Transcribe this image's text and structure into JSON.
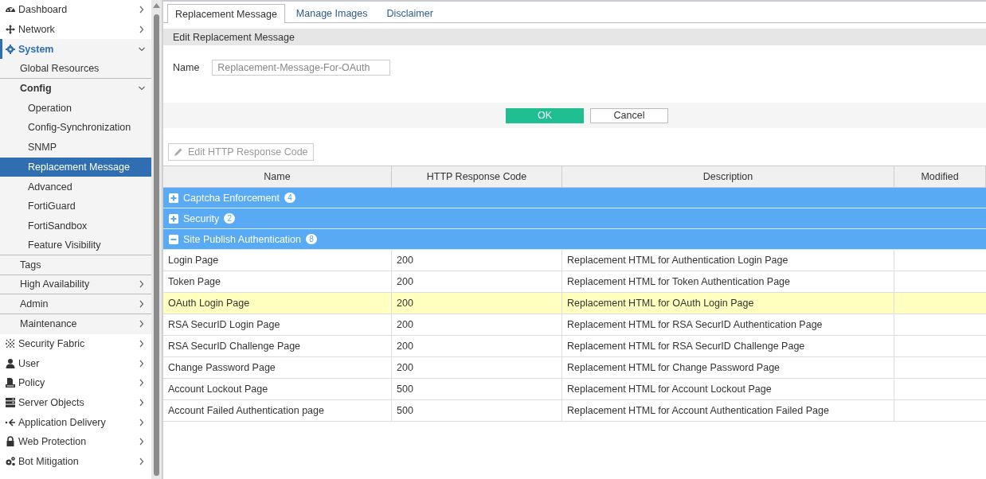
{
  "sidebar": {
    "items": [
      {
        "label": "Dashboard",
        "expanded": false,
        "selected": false
      },
      {
        "label": "Network",
        "expanded": false,
        "selected": false
      },
      {
        "label": "System",
        "expanded": true,
        "selected": false,
        "children": [
          {
            "label": "Global Resources",
            "selected": false
          },
          {
            "label": "Config",
            "expanded": true,
            "selected": false,
            "children": [
              {
                "label": "Operation",
                "selected": false
              },
              {
                "label": "Config-Synchronization",
                "selected": false
              },
              {
                "label": "SNMP",
                "selected": false
              },
              {
                "label": "Replacement Message",
                "selected": true
              },
              {
                "label": "Advanced",
                "selected": false
              },
              {
                "label": "FortiGuard",
                "selected": false
              },
              {
                "label": "FortiSandbox",
                "selected": false
              },
              {
                "label": "Feature Visibility",
                "selected": false
              }
            ]
          },
          {
            "label": "Tags",
            "selected": false
          },
          {
            "label": "High Availability",
            "expanded": false,
            "selected": false
          },
          {
            "label": "Admin",
            "expanded": false,
            "selected": false
          },
          {
            "label": "Maintenance",
            "expanded": false,
            "selected": false
          }
        ]
      },
      {
        "label": "Security Fabric",
        "expanded": false,
        "selected": false
      },
      {
        "label": "User",
        "expanded": false,
        "selected": false
      },
      {
        "label": "Policy",
        "expanded": false,
        "selected": false
      },
      {
        "label": "Server Objects",
        "expanded": false,
        "selected": false
      },
      {
        "label": "Application Delivery",
        "expanded": false,
        "selected": false
      },
      {
        "label": "Web Protection",
        "expanded": false,
        "selected": false
      },
      {
        "label": "Bot Mitigation",
        "expanded": false,
        "selected": false
      }
    ]
  },
  "tabs": [
    {
      "label": "Replacement Message",
      "selected": true
    },
    {
      "label": "Manage Images",
      "selected": false
    },
    {
      "label": "Disclaimer",
      "selected": false
    }
  ],
  "section_title": "Edit Replacement Message",
  "name_field": {
    "label": "Name",
    "value": "Replacement-Message-For-OAuth",
    "disabled": true
  },
  "buttons": [
    {
      "label": "OK",
      "kind": "primary"
    },
    {
      "label": "Cancel",
      "kind": "secondary"
    }
  ],
  "toolbar": {
    "label": "Edit HTTP Response Code",
    "disabled": true
  },
  "table": {
    "columns": [
      "Name",
      "HTTP Response Code",
      "Description",
      "Modified"
    ],
    "groups": [
      {
        "label": "Captcha Enforcement",
        "count": "4",
        "expanded": false
      },
      {
        "label": "Security",
        "count": "2",
        "expanded": false
      },
      {
        "label": "Site Publish Authentication",
        "count": "8",
        "expanded": true,
        "rows": [
          {
            "cells": [
              "Login Page",
              "200",
              "Replacement HTML for Authentication Login Page"
            ],
            "selected": false
          },
          {
            "cells": [
              "Token Page",
              "200",
              "Replacement HTML for Token Authentication Page"
            ],
            "selected": false
          },
          {
            "cells": [
              "OAuth Login Page",
              "200",
              "Replacement HTML for OAuth Login Page"
            ],
            "selected": true
          },
          {
            "cells": [
              "RSA SecurID Login Page",
              "200",
              "Replacement HTML for RSA SecurID Authentication Page"
            ],
            "selected": false
          },
          {
            "cells": [
              "RSA SecurID Challenge Page",
              "200",
              "Replacement HTML for RSA SecurID Challenge Page"
            ],
            "selected": false
          },
          {
            "cells": [
              "Change Password Page",
              "200",
              "Replacement HTML for Change Password Page"
            ],
            "selected": false
          },
          {
            "cells": [
              "Account Lockout Page",
              "500",
              "Replacement HTML for Account Lockout Page"
            ],
            "selected": false
          },
          {
            "cells": [
              "Account Failed Authentication page",
              "500",
              "Replacement HTML for Account Authentication Failed Page"
            ],
            "selected": false
          }
        ]
      }
    ]
  }
}
